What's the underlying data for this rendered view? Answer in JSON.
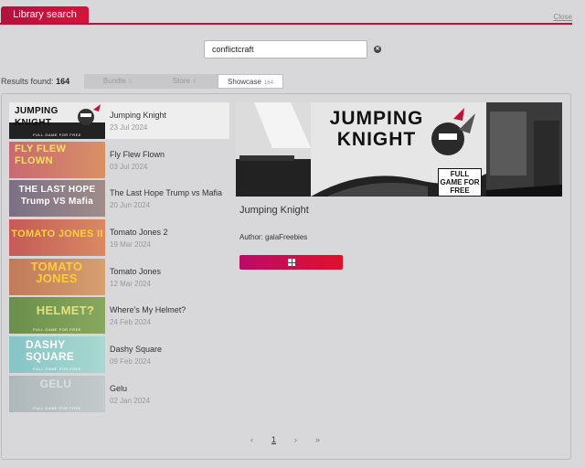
{
  "header": {
    "tab_label": "Library search",
    "close_label": "Close"
  },
  "search": {
    "value": "conflictcraft",
    "clear_icon": "clear-circle-icon"
  },
  "results": {
    "label": "Results found:",
    "count": "164"
  },
  "tabs": [
    {
      "label": "Bundle",
      "count": "0",
      "active": false
    },
    {
      "label": "Store",
      "count": "0",
      "active": false
    },
    {
      "label": "Showcase",
      "count": "164",
      "active": true
    }
  ],
  "games": [
    {
      "title": "Jumping Knight",
      "date": "23 Jul 2024",
      "thumb_text": "JUMPING KNIGHT",
      "thumb_foot": "FULL GAME FOR FREE",
      "thumb_bg": "#ebebeb",
      "thumb_fg": "#111111",
      "selected": true
    },
    {
      "title": "Fly Flew Flown",
      "date": "03 Jul 2024",
      "thumb_text": "FLY FLEW FLOWN",
      "thumb_foot": "",
      "thumb_bg": "#d07a72",
      "thumb_fg": "#f2e25a",
      "selected": false
    },
    {
      "title": "The Last Hope Trump vs Mafia",
      "date": "20 Jun 2024",
      "thumb_text": "THE LAST HOPE Trump VS Mafia",
      "thumb_foot": "",
      "thumb_bg": "#8c7d8c",
      "thumb_fg": "#ffffff",
      "selected": false
    },
    {
      "title": "Tomato Jones 2",
      "date": "19 Mar 2024",
      "thumb_text": "TOMATO JONES II",
      "thumb_foot": "",
      "thumb_bg": "#c96a5c",
      "thumb_fg": "#ffd23a",
      "selected": false
    },
    {
      "title": "Tomato Jones",
      "date": "12 Mar 2024",
      "thumb_text": "TOMATO JONES",
      "thumb_foot": "",
      "thumb_bg": "#c9825c",
      "thumb_fg": "#ffcc33",
      "selected": false
    },
    {
      "title": "Where's My Helmet?",
      "date": "24 Feb 2024",
      "thumb_text": "HELMET?",
      "thumb_foot": "FULL GAME FOR FREE",
      "thumb_bg": "#6f9a52",
      "thumb_fg": "#e8e07a",
      "selected": false
    },
    {
      "title": "Dashy Square",
      "date": "09 Feb 2024",
      "thumb_text": "DASHY SQUARE",
      "thumb_foot": "FULL GAME FOR FREE",
      "thumb_bg": "#8fc8c8",
      "thumb_fg": "#ffffff",
      "selected": false
    },
    {
      "title": "Gelu",
      "date": "02 Jan 2024",
      "thumb_text": "GELU",
      "thumb_foot": "FULL GAME FOR FREE",
      "thumb_bg": "#b7bfc0",
      "thumb_fg": "#d9e0e2",
      "selected": false
    }
  ],
  "detail": {
    "title": "Jumping Knight",
    "author_label": "Author:",
    "author": "galaFreebies",
    "hero_text": "JUMPING KNIGHT",
    "hero_badge": "FULL GAME FOR FREE",
    "platform_icon": "windows-icon"
  },
  "pagination": {
    "prev": "‹",
    "current": "1",
    "next": "›",
    "last": "»"
  },
  "colors": {
    "accent": "#c01038",
    "button_start": "#b80c6a",
    "button_end": "#e0112a"
  }
}
